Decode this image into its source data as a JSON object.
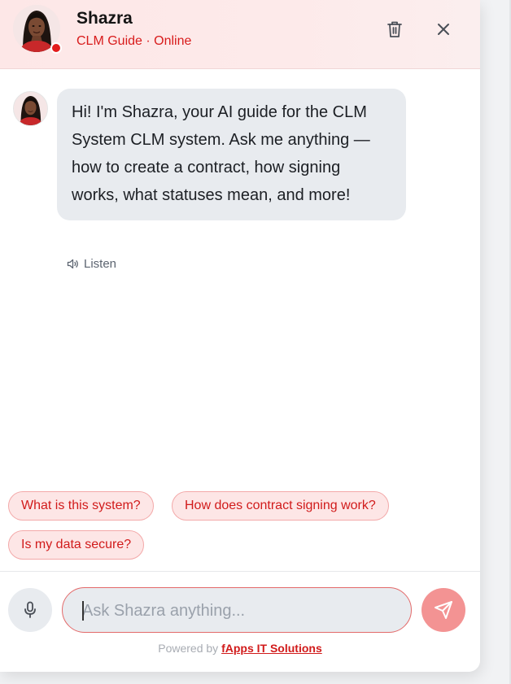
{
  "header": {
    "name": "Shazra",
    "status": "CLM Guide · Online",
    "avatar_icon": "woman-portrait-avatar",
    "online_dot_color": "#e31b1b",
    "actions": {
      "clear_icon": "trash-icon",
      "close_icon": "close-icon"
    }
  },
  "messages": [
    {
      "sender": "assistant",
      "text": "Hi! I'm Shazra, your AI guide for the CLM System CLM system. Ask me anything — how to create a contract, how signing works, what statuses mean, and more!",
      "listen_label": "Listen",
      "listen_icon": "speaker-icon"
    }
  ],
  "suggestions": [
    "What is this system?",
    "How does contract signing work?",
    "Is my data secure?"
  ],
  "composer": {
    "placeholder": "Ask Shazra anything...",
    "value": "",
    "mic_icon": "microphone-icon",
    "send_icon": "send-icon"
  },
  "footer": {
    "prefix": "Powered by",
    "link_text": "fApps IT Solutions"
  },
  "colors": {
    "accent": "#d11b1b",
    "header_bg": "#fde7e7",
    "bubble_bg": "#e8ebef",
    "send_button": "#f39393"
  }
}
